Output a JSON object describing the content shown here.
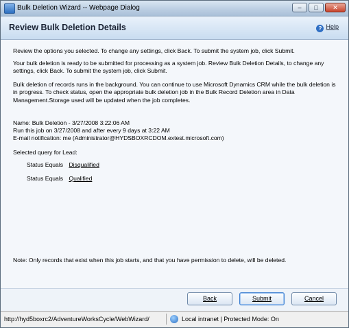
{
  "window": {
    "title": "Bulk Deletion Wizard -- Webpage Dialog"
  },
  "header": {
    "title": "Review Bulk Deletion Details",
    "help_label": "Help"
  },
  "content": {
    "intro": "Review the options you selected. To change any settings, click Back. To submit the system job, click Submit.",
    "para1": "Your bulk deletion is ready to be submitted for processing as a system job. Review Bulk Deletion Details, to change any settings, click Back. To submit the system job, click Submit.",
    "para2": "Bulk deletion of records runs in the background. You can continue to use Microsoft Dynamics CRM while the bulk deletion is in progress. To check status, open the appropriate bulk deletion job in the Bulk Record Deletion area in Data Management.Storage used will be updated when the job completes.",
    "name_line": "Name: Bulk Deletion - 3/27/2008 3:22:06 AM",
    "run_line": "Run this job on 3/27/2008 and after every 9 days at 3:22 AM",
    "email_line": "E-mail notification: me (Administrator@HYDSBOXRCDOM.extest.microsoft.com)",
    "query_heading": "Selected query for Lead:",
    "conditions": [
      {
        "field": "Status",
        "operator": "Equals",
        "value": "Disqualified"
      },
      {
        "field": "Status",
        "operator": "Equals",
        "value": "Qualified"
      }
    ],
    "note": "Note: Only records that exist when this job starts, and that you have permission to delete, will be deleted."
  },
  "buttons": {
    "back": "Back",
    "submit": "Submit",
    "cancel": "Cancel"
  },
  "statusbar": {
    "url": "http://hyd5boxrc2/AdventureWorksCycle/WebWizard/",
    "zone": "Local intranet | Protected Mode: On"
  }
}
